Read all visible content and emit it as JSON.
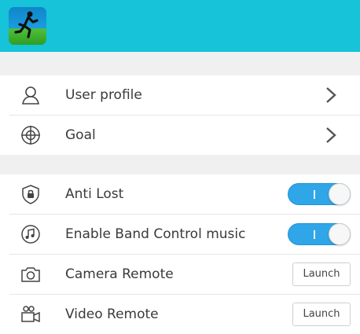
{
  "header": {
    "icon": "running-man-app-icon",
    "background": "#16c3d9"
  },
  "section1": [
    {
      "icon": "user-icon",
      "label": "User profile"
    },
    {
      "icon": "target-icon",
      "label": "Goal"
    }
  ],
  "section2": [
    {
      "icon": "shield-lock-icon",
      "label": "Anti Lost",
      "toggle_on": true
    },
    {
      "icon": "music-note-icon",
      "label": "Enable Band Control music",
      "toggle_on": true
    },
    {
      "icon": "camera-icon",
      "label": "Camera Remote",
      "button": "Launch"
    },
    {
      "icon": "video-camera-icon",
      "label": "Video Remote",
      "button": "Launch"
    }
  ],
  "colors": {
    "accent": "#2fa6e7",
    "header": "#16c3d9"
  }
}
